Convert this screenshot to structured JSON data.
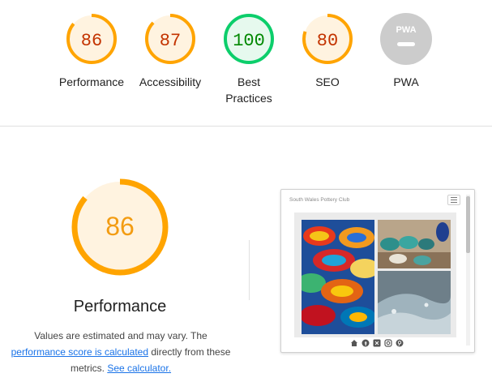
{
  "gauges": [
    {
      "label": "Performance",
      "score": 86,
      "fraction": 0.86,
      "status": "average"
    },
    {
      "label": "Accessibility",
      "score": 87,
      "fraction": 0.87,
      "status": "average"
    },
    {
      "label": "Best Practices",
      "line1": "Best",
      "line2": "Practices",
      "score": 100,
      "fraction": 1.0,
      "status": "pass"
    },
    {
      "label": "SEO",
      "score": 80,
      "fraction": 0.8,
      "status": "average"
    },
    {
      "label": "PWA",
      "badge": "PWA",
      "status": "not-applicable"
    }
  ],
  "performance": {
    "score": 86,
    "fraction": 0.86,
    "title": "Performance",
    "desc_part1": "Values are estimated and may vary. The",
    "link1": "performance score is calculated",
    "desc_part2": "directly from these metrics.",
    "link2": "See calculator."
  },
  "screenshot": {
    "site_name": "South Wales Pottery Club",
    "social_icons": [
      "home-icon",
      "facebook-icon",
      "x-twitter-icon",
      "instagram-icon",
      "pinterest-icon"
    ]
  },
  "colors": {
    "average": "#ffa400",
    "average_bg": "#fff3e0",
    "average_text": "#c33300",
    "pass": "#0cce6b",
    "pass_bg": "#e6f9ee",
    "pass_text": "#008800",
    "na": "#cccccc",
    "link": "#1a73e8"
  }
}
